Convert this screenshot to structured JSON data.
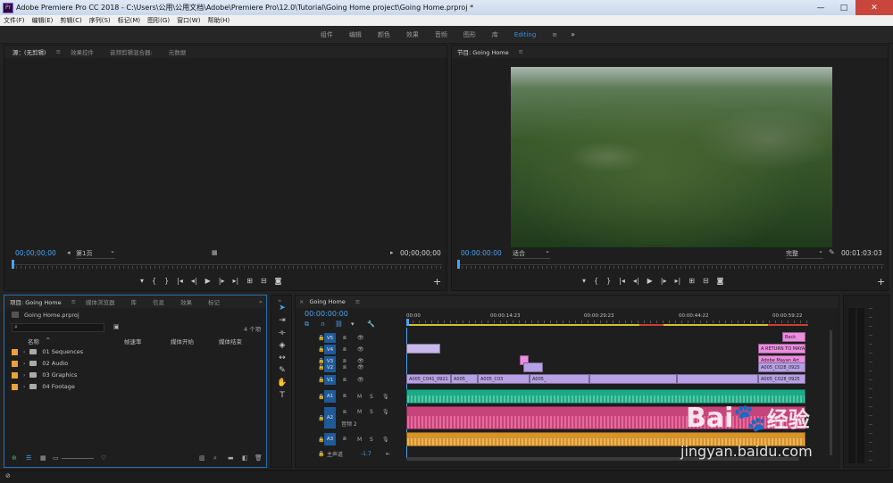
{
  "window": {
    "title": "Adobe Premiere Pro CC 2018 - C:\\Users\\公用\\公用文档\\Adobe\\Premiere Pro\\12.0\\Tutorial\\Going Home project\\Going Home.prproj *",
    "app_badge": "Pr",
    "minimize": "—",
    "maximize": "□",
    "close": "✕"
  },
  "menu": [
    "文件(F)",
    "编辑(E)",
    "剪辑(C)",
    "序列(S)",
    "标记(M)",
    "图形(G)",
    "窗口(W)",
    "帮助(H)"
  ],
  "workspaces": {
    "items": [
      "组件",
      "编辑",
      "颜色",
      "效果",
      "音频",
      "图形",
      "库",
      "Editing"
    ],
    "active": "Editing",
    "more": "»"
  },
  "source_panel": {
    "tabs": [
      "源：(无剪辑)",
      "效果控件",
      "音频剪辑混合器:",
      "元数据"
    ],
    "timecode_left": "00;00;00;00",
    "page": "第1页",
    "timecode_right": "00;00;00;00"
  },
  "program_panel": {
    "tab": "节目: Going Home",
    "timecode_left": "00:00:00:00",
    "fit": "适合",
    "quality": "完整",
    "timecode_right": "00:01:03:03"
  },
  "transport_icons": [
    "marker",
    "in",
    "out",
    "go-in",
    "step-back",
    "play",
    "step-fwd",
    "go-out",
    "insert",
    "overwrite",
    "camera"
  ],
  "project_panel": {
    "tabs": [
      "项目: Going Home",
      "媒体浏览器",
      "库",
      "信息",
      "效果",
      "标记"
    ],
    "more": "»",
    "file": "Going Home.prproj",
    "item_count": "4 个项",
    "columns": [
      "名称",
      "帧速率",
      "媒体开始",
      "媒体结束"
    ],
    "items": [
      {
        "name": "01 Sequences"
      },
      {
        "name": "02 Audio"
      },
      {
        "name": "03 Graphics"
      },
      {
        "name": "04 Footage"
      }
    ]
  },
  "timeline": {
    "tab": "Going Home",
    "timecode": "00:00:00:00",
    "ruler": [
      "00:00",
      "00:00:14:23",
      "00:00:29:23",
      "00:00:44:22",
      "00:00:59:22"
    ],
    "video_tracks": [
      {
        "label": "V5"
      },
      {
        "label": "V4"
      },
      {
        "label": "V3"
      },
      {
        "label": "V2"
      },
      {
        "label": "V1"
      }
    ],
    "audio_tracks": [
      {
        "label": "A1",
        "m": "M",
        "s": "S"
      },
      {
        "label": "A2",
        "m": "M",
        "s": "S",
        "name": "音频 2"
      },
      {
        "label": "A3",
        "m": "M",
        "s": "S"
      }
    ],
    "master": {
      "label": "主声道",
      "value": "-1.7"
    },
    "clips": {
      "v5": "Back",
      "v4a": "A RETURN TO MAYA",
      "v3": "Adobe Mayan Art",
      "v2": "A005_C028_0925",
      "v1a": "A005_C041_0921",
      "v1b": "A005_",
      "v1c": "A005_C03",
      "v1d": "A005_",
      "v1e": "A005_C028_0925"
    }
  },
  "colors": {
    "accent": "#4aa3f0",
    "video_clip": "#b7a1e4",
    "audio1": "#1da985",
    "audio2": "#c7447a",
    "audio3": "#d6932c",
    "folder_label": "#e8a23a"
  },
  "watermark": {
    "brand": "Bai",
    "brand2": "经验",
    "url": "jingyan.baidu.com"
  }
}
